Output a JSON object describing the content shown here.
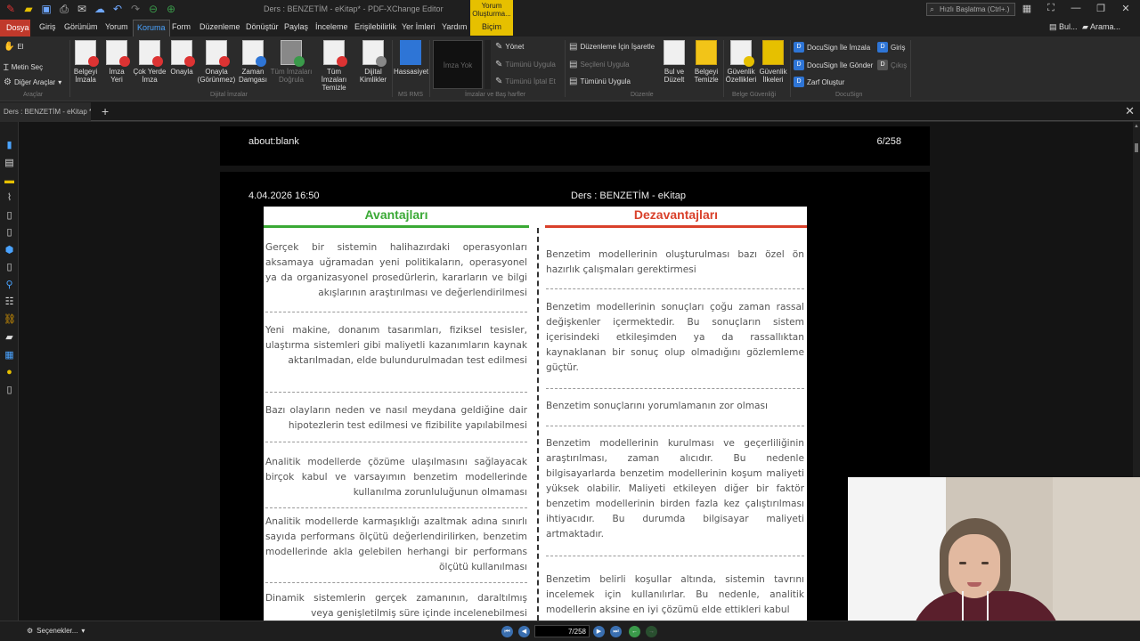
{
  "window": {
    "title": "Ders : BENZETİM - eKitap* - PDF-XChange Editor",
    "search_placeholder": "Hızlı Başlatma (Ctrl+.)",
    "context_tab": {
      "line1": "Yorum",
      "line2": "Oluşturma...",
      "label": "Biçim"
    }
  },
  "menu": {
    "file": "Dosya",
    "tabs": [
      "Giriş",
      "Görünüm",
      "Yorum",
      "Koruma",
      "Form",
      "Düzenleme",
      "Dönüştür",
      "Paylaş",
      "İnceleme",
      "Erişilebilirlik",
      "Yer İmleri",
      "Yardım"
    ],
    "active": "Koruma",
    "right": {
      "find": "Bul...",
      "search": "Arama..."
    }
  },
  "ribbon": {
    "tools": {
      "hand": "El",
      "select_text": "Metin Seç",
      "other_tools": "Diğer Araçlar",
      "group": "Araçlar"
    },
    "digital_ids": {
      "buttons": [
        {
          "label": "Belgeyi İmzala",
          "badge": "#d33"
        },
        {
          "label": "İmza Yeri",
          "badge": "#d33"
        },
        {
          "label": "Çok Yerde İmza",
          "badge": "#d33"
        },
        {
          "label": "Onayla",
          "badge": "#d33"
        },
        {
          "label": "Onayla (Görünmez)",
          "badge": "#d33"
        },
        {
          "label": "Zaman Damgası",
          "badge": "#2e75d6"
        },
        {
          "label": "Tüm İmzaları Doğrula",
          "badge": "#3a9a4a",
          "disabled": true
        },
        {
          "label": "Tüm İmzaları Temizle",
          "badge": "#d33"
        },
        {
          "label": "Dijital Kimlikler",
          "badge": "#888"
        }
      ],
      "group": "Dijital İmzalar"
    },
    "ms_rms": {
      "label": "Hassasiyet",
      "group": "MS RMS"
    },
    "signatures": {
      "placeholder": "İmza Yok",
      "manage": "Yönet",
      "apply_all": "Tümünü Uygula",
      "delete_all": "Tümünü İptal Et",
      "group": "İmzalar ve Baş harfler"
    },
    "redaction": {
      "mark": "Düzenleme İçin İşaretle",
      "apply_selected": "Seçileni Uygula",
      "apply_all": "Tümünü Uygula",
      "find_redact": "Bul ve Düzelt",
      "sanitize": "Belgeyi Temizle",
      "group": "Düzenle"
    },
    "security": {
      "props": "Güvenlik Özellikleri",
      "policies": "Güvenlik İlkeleri",
      "group": "Belge Güvenliği"
    },
    "docusign": {
      "sign": "DocuSign İle İmzala",
      "send": "DocuSign İle Gönder",
      "envelope": "Zarf Oluştur",
      "login": "Giriş",
      "logout": "Çıkış",
      "group": "DocuSign"
    }
  },
  "doc_tab": {
    "title": "Ders : BENZETİM - eKitap *"
  },
  "pages": {
    "prev_page": {
      "header_left": "about:blank",
      "header_right": "6/258"
    },
    "current_page": {
      "header_left": "4.04.2026 16:50",
      "header_center": "Ders : BENZETİM - eKitap"
    }
  },
  "scan": {
    "advantages_title": "Avantajları",
    "disadvantages_title": "Dezavantajları",
    "advantages": [
      "Gerçek bir sistemin halihazırdaki operasyonları aksamaya uğramadan yeni politikaların, operasyonel ya da organizasyonel prosedürlerin, kararların ve bilgi akışlarının araştırılması ve değerlendirilmesi",
      "Yeni makine, donanım tasarımları, fiziksel tesisler, ulaştırma sistemleri gibi maliyetli kazanımların kaynak aktarılmadan, elde bulundurulmadan test edilmesi",
      "Bazı olayların neden ve nasıl meydana geldiğine dair hipotezlerin test edilmesi ve fizibilite yapılabilmesi",
      "Analitik modellerde çözüme ulaşılmasını sağlayacak birçok kabul ve varsayımın benzetim modellerinde kullanılma zorunluluğunun olmaması",
      "Analitik modellerde karmaşıklığı azaltmak adına sınırlı sayıda performans ölçütü değerlendirilirken, benzetim modellerinde akla gelebilen herhangi bir performans ölçütü kullanılması",
      "Dinamik sistemlerin gerçek zamanının, daraltılmış veya genişletilmiş süre içinde incelenebilmesi"
    ],
    "disadvantages": [
      "Benzetim modellerinin oluşturulması bazı özel ön hazırlık çalışmaları gerektirmesi",
      "Benzetim modellerinin sonuçları çoğu zaman rassal değişkenler içermektedir. Bu sonuçların sistem içerisindeki etkileşimden ya da rassallıktan kaynaklanan bir sonuç olup olmadığını gözlemleme güçtür.",
      "Benzetim sonuçlarını yorumlamanın zor olması",
      "Benzetim modellerinin kurulması ve geçerliliğinin araştırılması, zaman alıcıdır. Bu nedenle bilgisayarlarda benzetim modellerinin koşum maliyeti yüksek olabilir. Maliyeti etkileyen diğer bir faktör benzetim modellerinin birden fazla kez çalıştırılması ihtiyacıdır. Bu durumda bilgisayar maliyeti artmaktadır.",
      "Benzetim belirli koşullar altında, sistemin tavrını incelemek için kullanılırlar. Bu nedenle, analitik modellerin aksine en iyi çözümü elde ettikleri kabul"
    ]
  },
  "statusbar": {
    "options": "Seçenekler...",
    "page_current": "7",
    "page_total": "/258"
  }
}
